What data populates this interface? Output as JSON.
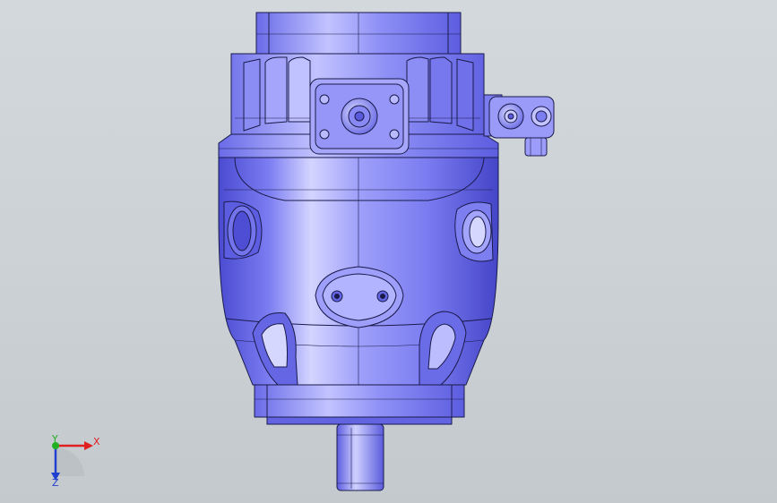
{
  "viewport": {
    "background": "#cfd5d9"
  },
  "model": {
    "body_color": "#7b7cf0",
    "edge_color": "#1a1a4a",
    "highlight_color": "#c8c9ff",
    "shadow_color": "#3f3fb8"
  },
  "triad": {
    "x_label": "X",
    "y_label": "Y",
    "z_label": "Z",
    "x_color": "#e02020",
    "y_color": "#20b020",
    "z_color": "#2040d0"
  }
}
